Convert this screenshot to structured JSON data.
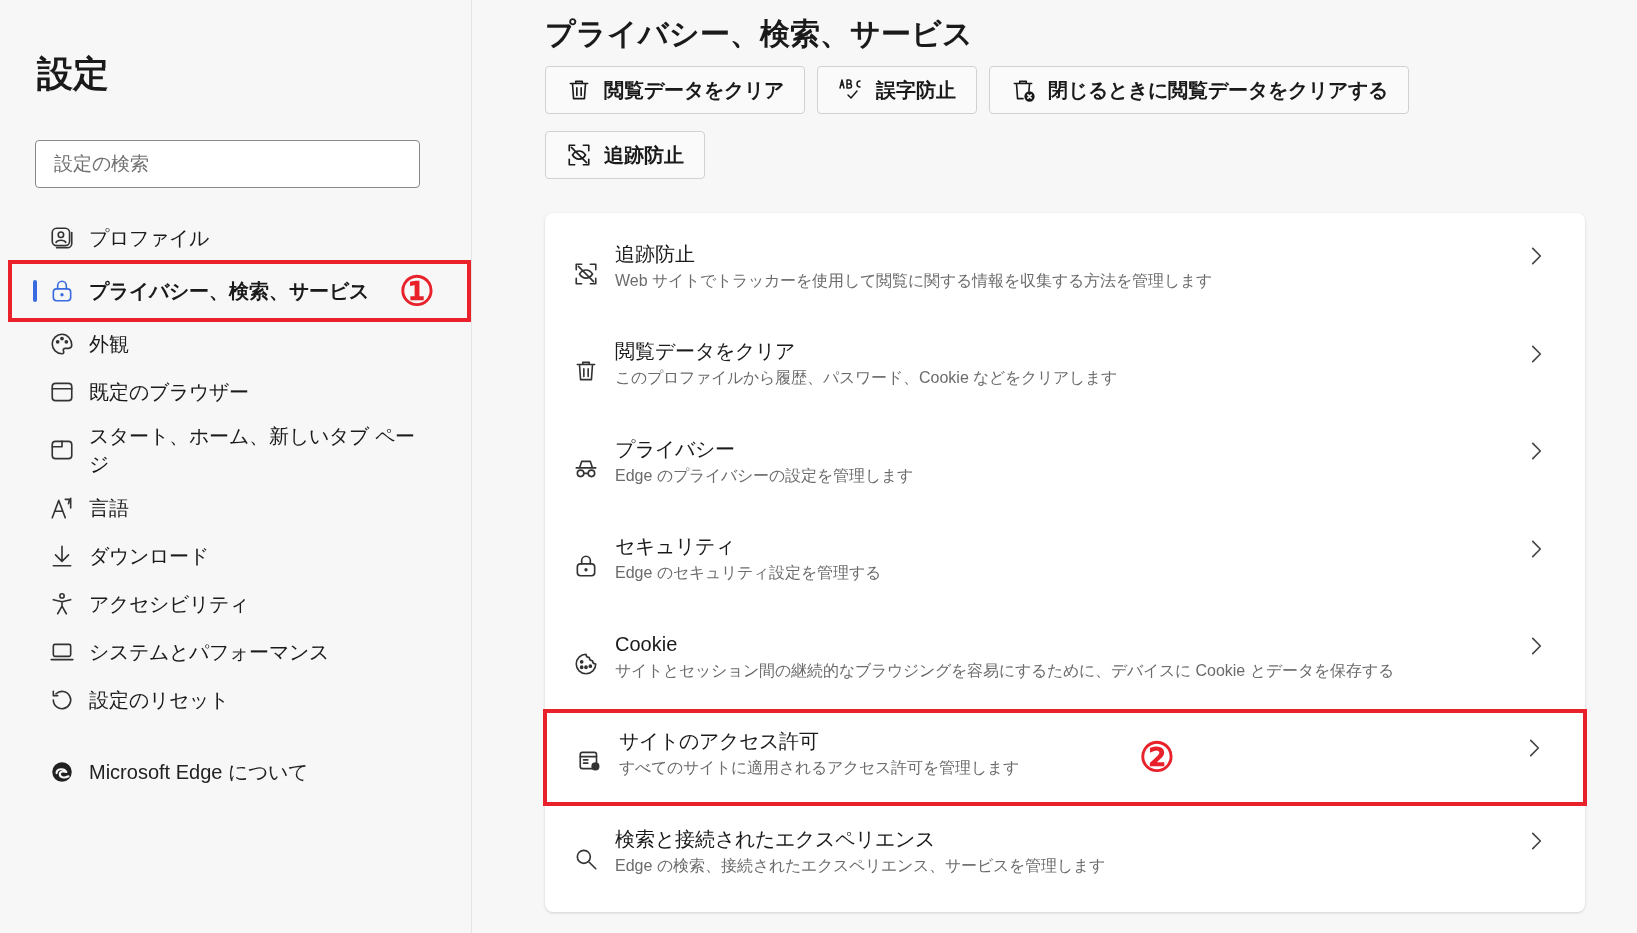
{
  "sidebar": {
    "title": "設定",
    "search": {
      "placeholder": "設定の検索"
    },
    "items": [
      {
        "label": "プロファイル",
        "selected": false
      },
      {
        "label": "プライバシー、検索、サービス",
        "selected": true,
        "callout": "①"
      },
      {
        "label": "外観",
        "selected": false
      },
      {
        "label": "既定のブラウザー",
        "selected": false
      },
      {
        "label": "スタート、ホーム、新しいタブ ページ",
        "selected": false
      },
      {
        "label": "言語",
        "selected": false
      },
      {
        "label": "ダウンロード",
        "selected": false
      },
      {
        "label": "アクセシビリティ",
        "selected": false
      },
      {
        "label": "システムとパフォーマンス",
        "selected": false
      },
      {
        "label": "設定のリセット",
        "selected": false
      }
    ],
    "about": "Microsoft Edge について"
  },
  "main": {
    "title": "プライバシー、検索、サービス",
    "quick_buttons": [
      "閲覧データをクリア",
      "誤字防止",
      "閉じるときに閲覧データをクリアする",
      "追跡防止"
    ],
    "rows": [
      {
        "title": "追跡防止",
        "description": "Web サイトでトラッカーを使用して閲覧に関する情報を収集する方法を管理します"
      },
      {
        "title": "閲覧データをクリア",
        "description": "このプロファイルから履歴、パスワード、Cookie などをクリアします"
      },
      {
        "title": "プライバシー",
        "description": "Edge のプライバシーの設定を管理します"
      },
      {
        "title": "セキュリティ",
        "description": "Edge のセキュリティ設定を管理する"
      },
      {
        "title": "Cookie",
        "description": "サイトとセッション間の継続的なブラウジングを容易にするために、デバイスに Cookie とデータを保存する"
      },
      {
        "title": "サイトのアクセス許可",
        "description": "すべてのサイトに適用されるアクセス許可を管理します",
        "callout": "②"
      },
      {
        "title": "検索と接続されたエクスペリエンス",
        "description": "Edge の検索、接続されたエクスペリエンス、サービスを管理します"
      }
    ]
  }
}
